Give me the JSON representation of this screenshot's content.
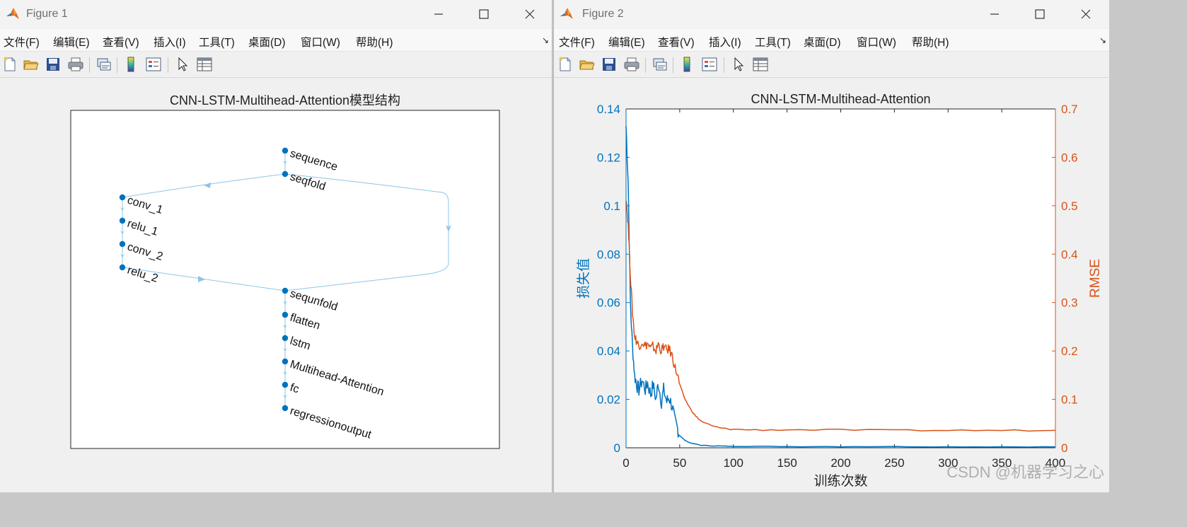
{
  "windows": [
    {
      "title": "Figure 1"
    },
    {
      "title": "Figure 2"
    }
  ],
  "menu": [
    "文件(F)",
    "编辑(E)",
    "查看(V)",
    "插入(I)",
    "工具(T)",
    "桌面(D)",
    "窗口(W)",
    "帮助(H)"
  ],
  "dock_glyph": "↘",
  "toolbar_icons": [
    "new-figure-icon",
    "open-file-icon",
    "save-icon",
    "print-icon",
    "link-icon",
    "colorbar-icon",
    "legend-icon",
    "pointer-icon",
    "property-inspector-icon"
  ],
  "colors": {
    "blue": "#0072bd",
    "orange": "#d95319",
    "edge": "#8cc6e6"
  },
  "figure1": {
    "title": "CNN-LSTM-Multihead-Attention模型结构",
    "nodes": [
      "sequence",
      "seqfold",
      "conv_1",
      "relu_1",
      "conv_2",
      "relu_2",
      "sequnfold",
      "flatten",
      "lstm",
      "Multihead-Attention",
      "fc",
      "regressionoutput"
    ]
  },
  "figure2": {
    "chart_data": {
      "type": "line",
      "title": "CNN-LSTM-Multihead-Attention",
      "xlabel": "训练次数",
      "ylabel_left": "损失值",
      "ylabel_right": "RMSE",
      "xlim": [
        0,
        400
      ],
      "ylim_left": [
        0,
        0.14
      ],
      "ylim_right": [
        0,
        0.7
      ],
      "xticks": [
        "0",
        "50",
        "100",
        "150",
        "200",
        "250",
        "300",
        "350",
        "400"
      ],
      "yticks_left": [
        "0",
        "0.02",
        "0.04",
        "0.06",
        "0.08",
        "0.1",
        "0.12",
        "0.14"
      ],
      "yticks_right": [
        "0",
        "0.1",
        "0.2",
        "0.3",
        "0.4",
        "0.5",
        "0.6",
        "0.7"
      ],
      "series": [
        {
          "axis": "left",
          "color": "#0072bd",
          "x": [
            0,
            2,
            4,
            6,
            8,
            10,
            12,
            15,
            18,
            20,
            23,
            25,
            28,
            30,
            33,
            35,
            38,
            40,
            43,
            45,
            48,
            50,
            55,
            60,
            65,
            70,
            80,
            90,
            100,
            120,
            150,
            200,
            250,
            300,
            350,
            400
          ],
          "y": [
            0.133,
            0.11,
            0.06,
            0.042,
            0.03,
            0.026,
            0.024,
            0.028,
            0.024,
            0.027,
            0.022,
            0.026,
            0.02,
            0.027,
            0.019,
            0.024,
            0.019,
            0.021,
            0.017,
            0.012,
            0.008,
            0.005,
            0.003,
            0.002,
            0.0015,
            0.001,
            0.0008,
            0.0007,
            0.0006,
            0.0006,
            0.0005,
            0.0005,
            0.0005,
            0.0004,
            0.0004,
            0.0004
          ]
        },
        {
          "axis": "right",
          "color": "#d95319",
          "x": [
            0,
            2,
            4,
            6,
            8,
            10,
            12,
            15,
            18,
            20,
            23,
            25,
            28,
            30,
            33,
            35,
            38,
            40,
            43,
            45,
            48,
            50,
            55,
            60,
            65,
            70,
            80,
            90,
            100,
            120,
            150,
            200,
            250,
            300,
            350,
            400
          ],
          "y": [
            0.52,
            0.46,
            0.36,
            0.28,
            0.23,
            0.22,
            0.21,
            0.22,
            0.21,
            0.215,
            0.205,
            0.21,
            0.2,
            0.215,
            0.2,
            0.21,
            0.2,
            0.205,
            0.19,
            0.17,
            0.15,
            0.13,
            0.1,
            0.08,
            0.065,
            0.055,
            0.045,
            0.04,
            0.038,
            0.037,
            0.037,
            0.037,
            0.036,
            0.036,
            0.036,
            0.036
          ]
        }
      ]
    }
  },
  "watermark": "CSDN @机器学习之心"
}
